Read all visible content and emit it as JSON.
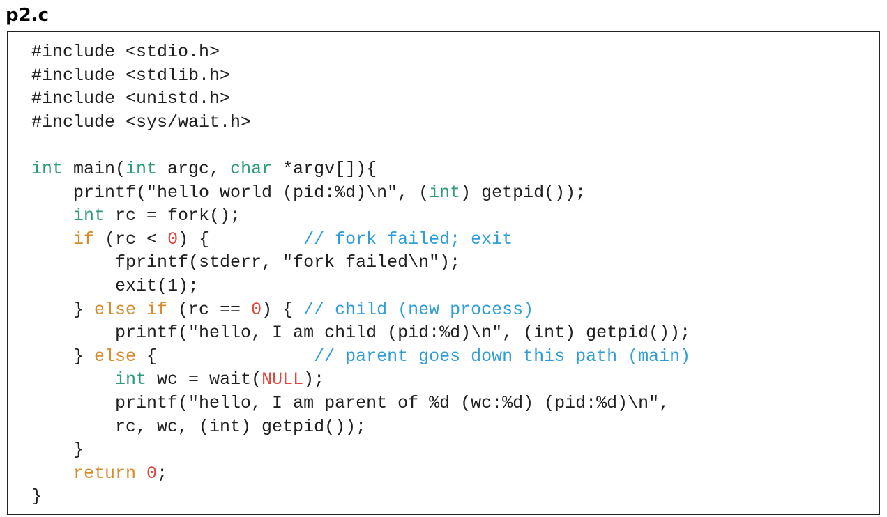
{
  "file": {
    "title": "p2.c"
  },
  "code": {
    "lines": [
      [
        {
          "t": "#include <stdio.h>",
          "c": "plain"
        }
      ],
      [
        {
          "t": "#include <stdlib.h>",
          "c": "plain"
        }
      ],
      [
        {
          "t": "#include <unistd.h>",
          "c": "plain"
        }
      ],
      [
        {
          "t": "#include <sys/wait.h>",
          "c": "plain"
        }
      ],
      [
        {
          "t": "",
          "c": "plain"
        }
      ],
      [
        {
          "t": "int",
          "c": "type"
        },
        {
          "t": " main(",
          "c": "plain"
        },
        {
          "t": "int",
          "c": "type"
        },
        {
          "t": " argc, ",
          "c": "plain"
        },
        {
          "t": "char",
          "c": "type"
        },
        {
          "t": " *argv[]){",
          "c": "plain"
        }
      ],
      [
        {
          "t": "    printf(\"hello world (pid:%d)\\n\", (",
          "c": "plain"
        },
        {
          "t": "int",
          "c": "type"
        },
        {
          "t": ") getpid());",
          "c": "plain"
        }
      ],
      [
        {
          "t": "    ",
          "c": "plain"
        },
        {
          "t": "int",
          "c": "type"
        },
        {
          "t": " rc = fork();",
          "c": "plain"
        }
      ],
      [
        {
          "t": "    ",
          "c": "plain"
        },
        {
          "t": "if",
          "c": "keyword"
        },
        {
          "t": " (rc < ",
          "c": "plain"
        },
        {
          "t": "0",
          "c": "number"
        },
        {
          "t": ") {         ",
          "c": "plain"
        },
        {
          "t": "// fork failed; exit",
          "c": "comment"
        }
      ],
      [
        {
          "t": "        fprintf(stderr, \"fork failed\\n\");",
          "c": "plain"
        }
      ],
      [
        {
          "t": "        exit(1);",
          "c": "plain"
        }
      ],
      [
        {
          "t": "    } ",
          "c": "plain"
        },
        {
          "t": "else if",
          "c": "keyword"
        },
        {
          "t": " (rc == ",
          "c": "plain"
        },
        {
          "t": "0",
          "c": "number"
        },
        {
          "t": ") { ",
          "c": "plain"
        },
        {
          "t": "// child (new process)",
          "c": "comment"
        }
      ],
      [
        {
          "t": "        printf(\"hello, I am child (pid:%d)\\n\", (int) getpid());",
          "c": "plain"
        }
      ],
      [
        {
          "t": "    } ",
          "c": "plain"
        },
        {
          "t": "else",
          "c": "keyword"
        },
        {
          "t": " {               ",
          "c": "plain"
        },
        {
          "t": "// parent goes down this path (main)",
          "c": "comment"
        }
      ],
      [
        {
          "t": "        ",
          "c": "plain"
        },
        {
          "t": "int",
          "c": "type"
        },
        {
          "t": " wc = wait(",
          "c": "plain"
        },
        {
          "t": "NULL",
          "c": "null"
        },
        {
          "t": ");",
          "c": "plain"
        }
      ],
      [
        {
          "t": "        printf(\"hello, I am parent of %d (wc:%d) (pid:%d)\\n\",",
          "c": "plain"
        }
      ],
      [
        {
          "t": "        rc, wc, (int) getpid());",
          "c": "plain"
        }
      ],
      [
        {
          "t": "    }",
          "c": "plain"
        }
      ],
      [
        {
          "t": "    ",
          "c": "plain"
        },
        {
          "t": "return",
          "c": "keyword"
        },
        {
          "t": " ",
          "c": "plain"
        },
        {
          "t": "0",
          "c": "number"
        },
        {
          "t": ";",
          "c": "plain"
        }
      ],
      [
        {
          "t": "}",
          "c": "plain"
        }
      ]
    ]
  },
  "colors": {
    "type": "#2e9b7d",
    "keyword": "#d98c2b",
    "number": "#e0473c",
    "comment": "#2f9ed8",
    "plain": "#202020"
  }
}
